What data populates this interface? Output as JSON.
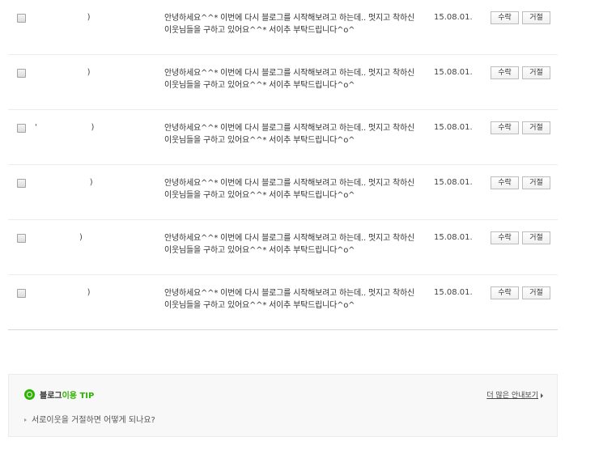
{
  "requests": [
    {
      "name": "                    )",
      "message": "안녕하세요^^* 이번에 다시 블로그를 시작해보려고 하는데.. 멋지고 착하신 이웃님들을 구하고 있어요^^* 서이추 부탁드립니다^o^",
      "date": "15.08.01.",
      "accept": "수락",
      "reject": "거절"
    },
    {
      "name": "                    )",
      "message": "안녕하세요^^* 이번에 다시 블로그를 시작해보려고 하는데.. 멋지고 착하신 이웃님들을 구하고 있어요^^* 서이추 부탁드립니다^o^",
      "date": "15.08.01.",
      "accept": "수락",
      "reject": "거절"
    },
    {
      "name": "'                     )",
      "message": "안녕하세요^^* 이번에 다시 블로그를 시작해보려고 하는데.. 멋지고 착하신 이웃님들을 구하고 있어요^^* 서이추 부탁드립니다^o^",
      "date": "15.08.01.",
      "accept": "수락",
      "reject": "거절"
    },
    {
      "name": "                     )",
      "message": "안녕하세요^^* 이번에 다시 블로그를 시작해보려고 하는데.. 멋지고 착하신 이웃님들을 구하고 있어요^^* 서이추 부탁드립니다^o^",
      "date": "15.08.01.",
      "accept": "수락",
      "reject": "거절"
    },
    {
      "name": "                 )",
      "message": "안녕하세요^^* 이번에 다시 블로그를 시작해보려고 하는데.. 멋지고 착하신 이웃님들을 구하고 있어요^^* 서이추 부탁드립니다^o^",
      "date": "15.08.01.",
      "accept": "수락",
      "reject": "거절"
    },
    {
      "name": "                    )",
      "message": "안녕하세요^^* 이번에 다시 블로그를 시작해보려고 하는데.. 멋지고 착하신 이웃님들을 구하고 있어요^^* 서이추 부탁드립니다^o^",
      "date": "15.08.01.",
      "accept": "수락",
      "reject": "거절"
    }
  ],
  "tip": {
    "title_black": "블로그",
    "title_green": "이용 TIP",
    "more_link": "더 많은 안내보기",
    "question": "서로이웃을 거절하면 어떻게 되나요?",
    "icon": "location-pin-icon",
    "accent_color": "#2db400"
  }
}
